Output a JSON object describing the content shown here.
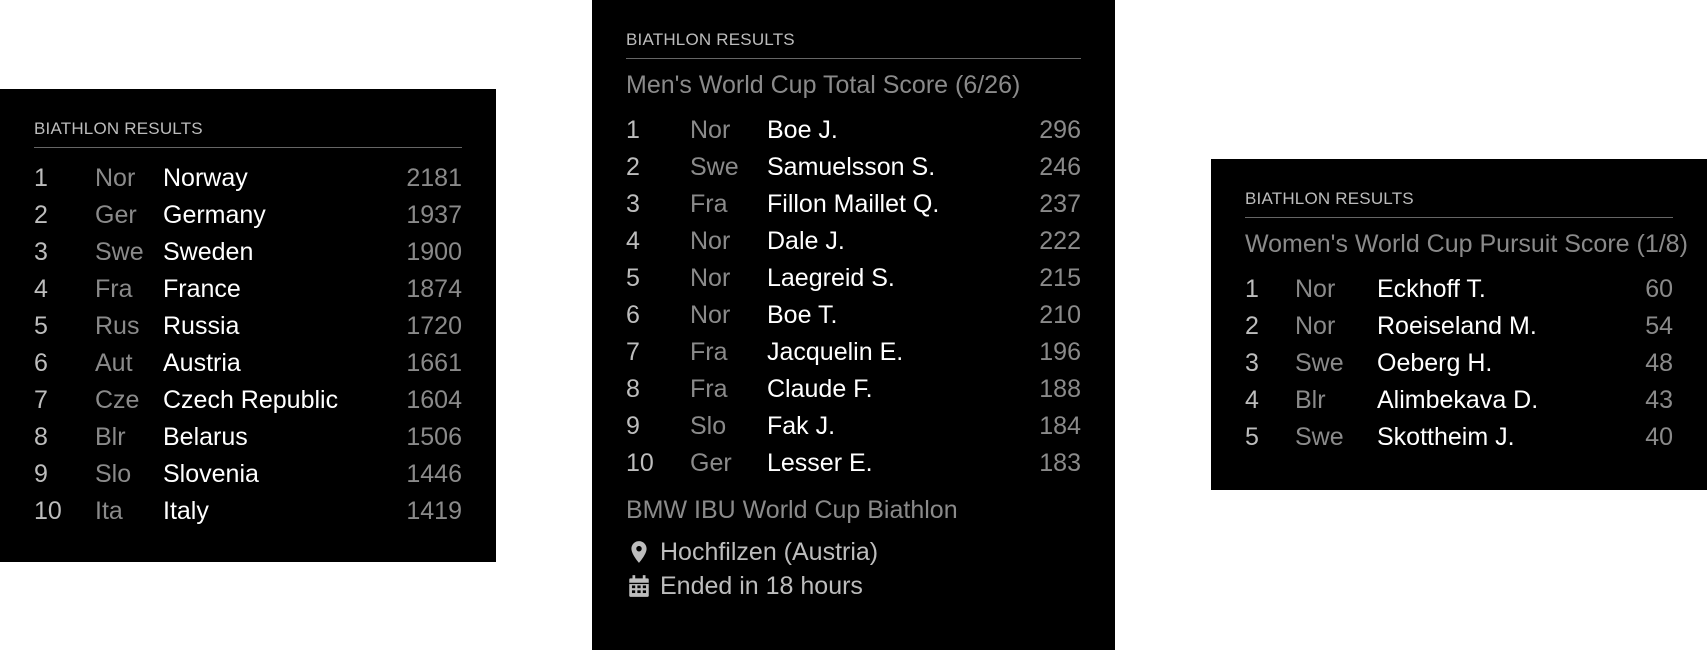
{
  "panels": [
    {
      "header": "BIATHLON RESULTS",
      "subtitle": "",
      "rows": [
        {
          "rank": "1",
          "nation": "Nor",
          "name": "Norway",
          "score": "2181"
        },
        {
          "rank": "2",
          "nation": "Ger",
          "name": "Germany",
          "score": "1937"
        },
        {
          "rank": "3",
          "nation": "Swe",
          "name": "Sweden",
          "score": "1900"
        },
        {
          "rank": "4",
          "nation": "Fra",
          "name": "France",
          "score": "1874"
        },
        {
          "rank": "5",
          "nation": "Rus",
          "name": "Russia",
          "score": "1720"
        },
        {
          "rank": "6",
          "nation": "Aut",
          "name": "Austria",
          "score": "1661"
        },
        {
          "rank": "7",
          "nation": "Cze",
          "name": "Czech Republic",
          "score": "1604"
        },
        {
          "rank": "8",
          "nation": "Blr",
          "name": "Belarus",
          "score": "1506"
        },
        {
          "rank": "9",
          "nation": "Slo",
          "name": "Slovenia",
          "score": "1446"
        },
        {
          "rank": "10",
          "nation": "Ita",
          "name": "Italy",
          "score": "1419"
        }
      ]
    },
    {
      "header": "BIATHLON RESULTS",
      "subtitle": "Men's World Cup Total Score (6/26)",
      "rows": [
        {
          "rank": "1",
          "nation": "Nor",
          "name": "Boe J.",
          "score": "296"
        },
        {
          "rank": "2",
          "nation": "Swe",
          "name": "Samuelsson S.",
          "score": "246"
        },
        {
          "rank": "3",
          "nation": "Fra",
          "name": "Fillon Maillet Q.",
          "score": "237"
        },
        {
          "rank": "4",
          "nation": "Nor",
          "name": "Dale J.",
          "score": "222"
        },
        {
          "rank": "5",
          "nation": "Nor",
          "name": "Laegreid S.",
          "score": "215"
        },
        {
          "rank": "6",
          "nation": "Nor",
          "name": "Boe T.",
          "score": "210"
        },
        {
          "rank": "7",
          "nation": "Fra",
          "name": "Jacquelin E.",
          "score": "196"
        },
        {
          "rank": "8",
          "nation": "Fra",
          "name": "Claude F.",
          "score": "188"
        },
        {
          "rank": "9",
          "nation": "Slo",
          "name": "Fak J.",
          "score": "184"
        },
        {
          "rank": "10",
          "nation": "Ger",
          "name": "Lesser E.",
          "score": "183"
        }
      ],
      "event": {
        "title": "BMW IBU World Cup Biathlon",
        "location": "Hochfilzen (Austria)",
        "location_icon": "map-marker-icon",
        "status": "Ended in 18 hours",
        "status_icon": "calendar-icon"
      }
    },
    {
      "header": "BIATHLON RESULTS",
      "subtitle": "Women's World Cup Pursuit Score (1/8)",
      "rows": [
        {
          "rank": "1",
          "nation": "Nor",
          "name": "Eckhoff T.",
          "score": "60"
        },
        {
          "rank": "2",
          "nation": "Nor",
          "name": "Roeiseland M.",
          "score": "54"
        },
        {
          "rank": "3",
          "nation": "Swe",
          "name": "Oeberg H.",
          "score": "48"
        },
        {
          "rank": "4",
          "nation": "Blr",
          "name": "Alimbekava D.",
          "score": "43"
        },
        {
          "rank": "5",
          "nation": "Swe",
          "name": "Skottheim J.",
          "score": "40"
        }
      ]
    }
  ],
  "colors": {
    "panel_background": "#000000",
    "page_background": "#ffffff",
    "primary_text": "#ffffff",
    "dim_text": "#8a8a8a",
    "header_text": "#bdbdbd"
  }
}
